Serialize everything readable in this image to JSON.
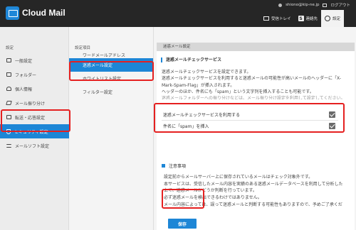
{
  "header": {
    "app_title": "Cloud Mail",
    "user_email": "shiono@kip-ne.jp",
    "logout_label": "ログアウト",
    "menu": [
      {
        "label": "受信トレイ",
        "icon": "mail-icon",
        "active": false
      },
      {
        "label": "連絡先",
        "icon": "contacts-icon",
        "active": false
      },
      {
        "label": "設定",
        "icon": "gear-icon",
        "active": true
      }
    ]
  },
  "left_nav": {
    "heading": "設定",
    "items": [
      {
        "label": "一般設定",
        "icon": "gear-icon"
      },
      {
        "label": "フォルダー",
        "icon": "folder-icon"
      },
      {
        "label": "個人情報",
        "icon": "person-icon"
      },
      {
        "label": "メール振り分け",
        "icon": "tag-icon"
      },
      {
        "label": "転送・応答設定",
        "icon": "forward-icon"
      },
      {
        "label": "セキュリティ設定",
        "icon": "shield-icon",
        "active": true
      },
      {
        "label": "メールソフト設定",
        "icon": "list-icon"
      }
    ]
  },
  "mid_nav": {
    "heading": "設定項目",
    "items": [
      {
        "label": "ワードメールアドレス",
        "partial": true
      },
      {
        "label": "迷惑メール設定",
        "active": true
      },
      {
        "label": "ホワイトリスト設定"
      },
      {
        "label": "フィルター設定"
      }
    ]
  },
  "content": {
    "section_title": "迷惑メール設定",
    "subheading": "迷惑メールチェックサービス",
    "description": [
      "迷惑メールチェックサービスを設定できます。",
      "迷惑メールチェックサービスを利用すると迷惑メールの可能性が高いメールのヘッダーに「X-",
      "Mark-Spam-Flag」が挿入されます。",
      "ヘッダーのほか、件名にも「spam」という文字列を挿入することも可能です。",
      "迷惑メールフォルダーへの振り分けなどは、メール振り分け設定を利用して設定してください。"
    ],
    "options": [
      {
        "label": "迷惑メールチェックサービスを利用する",
        "checked": true
      },
      {
        "label": "件名に「spam」を挿入",
        "checked": true
      }
    ],
    "notice_title": "注意事項",
    "notice": [
      "設定前からメールサーバー上に保存されているメールはチェック対象外です。",
      "本サービスは、受信したメール内容を実績のある迷惑メールデータベースを利用して分析した",
      "上で、迷惑メールかどうか判断を行っています。",
      "必ず迷惑メールを検出できるわけではありません。",
      "メール内容によっては、誤って迷惑メールと判断する可能性もありますので、予めご了承くだ"
    ],
    "save_label": "保存"
  },
  "colors": {
    "accent": "#1d86d6",
    "highlight": "#e52020",
    "header_bg": "#262626"
  }
}
